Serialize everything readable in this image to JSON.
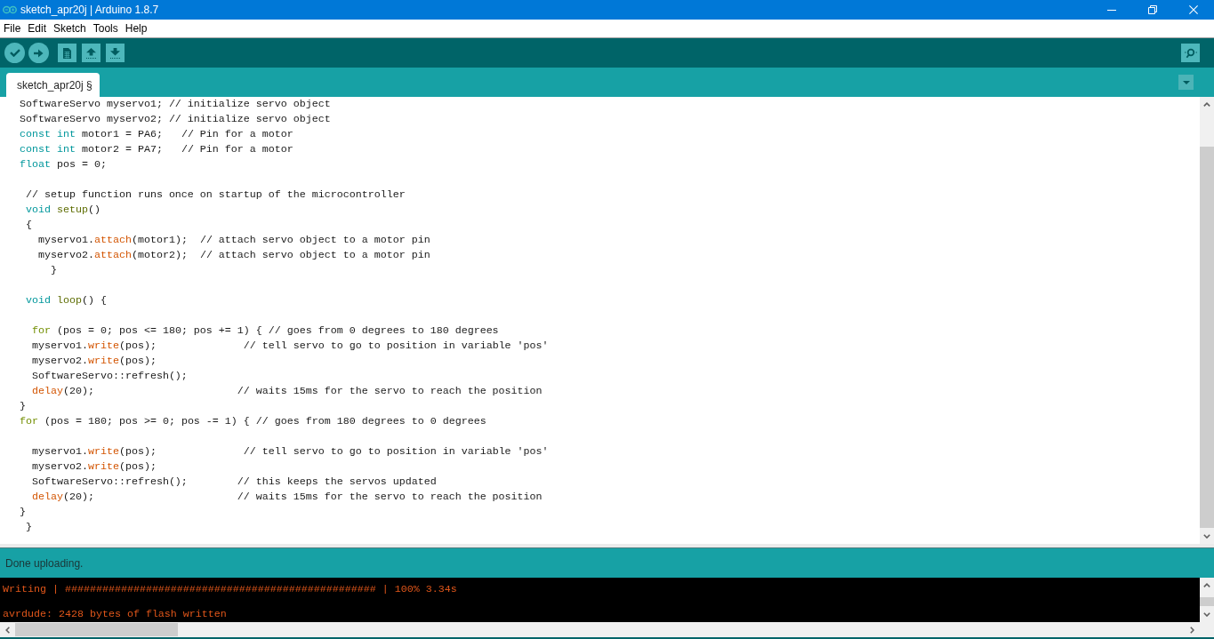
{
  "window": {
    "title": "sketch_apr20j | Arduino 1.8.7"
  },
  "menu": [
    "File",
    "Edit",
    "Sketch",
    "Tools",
    "Help"
  ],
  "tabs": [
    {
      "label": "sketch_apr20j §",
      "selected": true
    }
  ],
  "editor": {
    "lines": [
      {
        "kind": "code",
        "tokens": [
          {
            "kind": "plain",
            "text": "SoftwareServo myservo1; // initialize servo object"
          }
        ]
      },
      {
        "kind": "code",
        "tokens": [
          {
            "kind": "plain",
            "text": "SoftwareServo myservo2; // initialize servo object"
          }
        ]
      },
      {
        "kind": "code",
        "tokens": [
          {
            "kind": "keyword",
            "text": "const int"
          },
          {
            "kind": "plain",
            "text": " motor1 = PA6;   // Pin for a motor"
          }
        ]
      },
      {
        "kind": "code",
        "tokens": [
          {
            "kind": "keyword",
            "text": "const int"
          },
          {
            "kind": "plain",
            "text": " motor2 = PA7;   // Pin for a motor"
          }
        ]
      },
      {
        "kind": "code",
        "tokens": [
          {
            "kind": "keyword",
            "text": "float"
          },
          {
            "kind": "plain",
            "text": " pos = 0;"
          }
        ]
      },
      {
        "kind": "blank"
      },
      {
        "kind": "code",
        "tokens": [
          {
            "kind": "plain",
            "text": " // setup function runs once on startup of the microcontroller"
          }
        ]
      },
      {
        "kind": "code",
        "tokens": [
          {
            "kind": "keyword",
            "text": " void"
          },
          {
            "kind": "function",
            "text": " setup"
          },
          {
            "kind": "plain",
            "text": "()"
          }
        ]
      },
      {
        "kind": "code",
        "tokens": [
          {
            "kind": "plain",
            "text": " {"
          }
        ]
      },
      {
        "kind": "code",
        "tokens": [
          {
            "kind": "plain",
            "text": "   myservo1."
          },
          {
            "kind": "method",
            "text": "attach"
          },
          {
            "kind": "plain",
            "text": "(motor1);  // attach servo object to a motor pin"
          }
        ]
      },
      {
        "kind": "code",
        "tokens": [
          {
            "kind": "plain",
            "text": "   myservo2."
          },
          {
            "kind": "method",
            "text": "attach"
          },
          {
            "kind": "plain",
            "text": "(motor2);  // attach servo object to a motor pin"
          }
        ]
      },
      {
        "kind": "code",
        "tokens": [
          {
            "kind": "plain",
            "text": "     }"
          }
        ]
      },
      {
        "kind": "blank"
      },
      {
        "kind": "code",
        "tokens": [
          {
            "kind": "keyword",
            "text": " void"
          },
          {
            "kind": "function",
            "text": " loop"
          },
          {
            "kind": "plain",
            "text": "() {"
          }
        ]
      },
      {
        "kind": "blank"
      },
      {
        "kind": "code",
        "tokens": [
          {
            "kind": "control",
            "text": "  for"
          },
          {
            "kind": "plain",
            "text": " (pos = 0; pos <= 180; pos += 1) { // goes from 0 degrees to 180 degrees"
          }
        ]
      },
      {
        "kind": "code",
        "tokens": [
          {
            "kind": "plain",
            "text": "  myservo1."
          },
          {
            "kind": "method",
            "text": "write"
          },
          {
            "kind": "plain",
            "text": "(pos);              // tell servo to go to position in variable 'pos'"
          }
        ]
      },
      {
        "kind": "code",
        "tokens": [
          {
            "kind": "plain",
            "text": "  myservo2."
          },
          {
            "kind": "method",
            "text": "write"
          },
          {
            "kind": "plain",
            "text": "(pos);"
          }
        ]
      },
      {
        "kind": "code",
        "tokens": [
          {
            "kind": "plain",
            "text": "  SoftwareServo::refresh();"
          }
        ]
      },
      {
        "kind": "code",
        "tokens": [
          {
            "kind": "method",
            "text": "  delay"
          },
          {
            "kind": "plain",
            "text": "(20);                       // waits 15ms for the servo to reach the position"
          }
        ]
      },
      {
        "kind": "code",
        "tokens": [
          {
            "kind": "plain",
            "text": "}"
          }
        ]
      },
      {
        "kind": "code",
        "tokens": [
          {
            "kind": "control",
            "text": "for"
          },
          {
            "kind": "plain",
            "text": " (pos = 180; pos >= 0; pos -= 1) { // goes from 180 degrees to 0 degrees"
          }
        ]
      },
      {
        "kind": "blank"
      },
      {
        "kind": "code",
        "tokens": [
          {
            "kind": "plain",
            "text": "  myservo1."
          },
          {
            "kind": "method",
            "text": "write"
          },
          {
            "kind": "plain",
            "text": "(pos);              // tell servo to go to position in variable 'pos'"
          }
        ]
      },
      {
        "kind": "code",
        "tokens": [
          {
            "kind": "plain",
            "text": "  myservo2."
          },
          {
            "kind": "method",
            "text": "write"
          },
          {
            "kind": "plain",
            "text": "(pos);"
          }
        ]
      },
      {
        "kind": "code",
        "tokens": [
          {
            "kind": "plain",
            "text": "  SoftwareServo::refresh();        // this keeps the servos updated"
          }
        ]
      },
      {
        "kind": "code",
        "tokens": [
          {
            "kind": "method",
            "text": "  delay"
          },
          {
            "kind": "plain",
            "text": "(20);                       // waits 15ms for the servo to reach the position"
          }
        ]
      },
      {
        "kind": "code",
        "tokens": [
          {
            "kind": "plain",
            "text": "}"
          }
        ]
      },
      {
        "kind": "code",
        "tokens": [
          {
            "kind": "plain",
            "text": " }"
          }
        ]
      }
    ]
  },
  "status_bar": {
    "message": "Done uploading."
  },
  "console": {
    "lines": [
      {
        "kind": "output",
        "text": "Writing | ################################################## | 100% 3.34s"
      },
      {
        "kind": "blank"
      },
      {
        "kind": "output",
        "text": "avrdude: 2428 bytes of flash written"
      }
    ]
  }
}
